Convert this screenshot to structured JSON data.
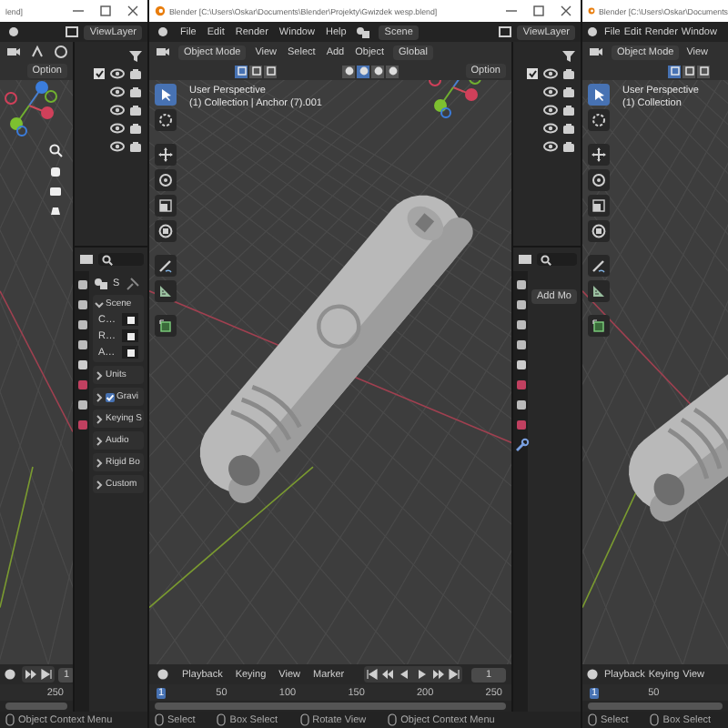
{
  "windows": [
    {
      "title": "lend]",
      "controls": true,
      "view_layer": "ViewLayer",
      "options": "Option",
      "gizmo": true,
      "nav_buttons": true,
      "outliner": true,
      "properties": {
        "breadcrumb": "S",
        "panels": [
          {
            "kind": "plain",
            "label": "Scene",
            "expanded": true,
            "rows": [
              "C…",
              "R…",
              "A…"
            ]
          },
          {
            "kind": "plain",
            "label": "Units",
            "expanded": false
          },
          {
            "kind": "checkbox",
            "label": "Gravi",
            "expanded": false,
            "checked": true
          },
          {
            "kind": "plain",
            "label": "Keying S",
            "expanded": false
          },
          {
            "kind": "plain",
            "label": "Audio",
            "expanded": false
          },
          {
            "kind": "plain",
            "label": "Rigid Bo",
            "expanded": false
          },
          {
            "kind": "plain",
            "label": "Custom",
            "expanded": false
          }
        ]
      },
      "timeline": {
        "frame": "1",
        "ruler": [
          {
            "label": "250",
            "selected": false
          }
        ]
      },
      "status": [
        "Object Context Menu"
      ]
    },
    {
      "title": "Blender [C:\\Users\\Oskar\\Documents\\Blender\\Projekty\\Gwizdek wesp.blend]",
      "app_icon": true,
      "controls": true,
      "menus": [
        "File",
        "Edit",
        "Render",
        "Window",
        "Help"
      ],
      "scene": "Scene",
      "view_layer": "ViewLayer",
      "mode": "Object Mode",
      "header_menus": [
        "View",
        "Select",
        "Add",
        "Object"
      ],
      "orientation": "Global",
      "options": "Option",
      "select_modes": [
        {
          "selected": true
        },
        {
          "selected": false
        },
        {
          "selected": false
        }
      ],
      "shading": [
        {
          "selected": false
        },
        {
          "selected": true
        },
        {
          "selected": false
        },
        {
          "selected": false
        }
      ],
      "info": [
        "User Perspective",
        "(1) Collection | Anchor (7).001"
      ],
      "tools": [
        {
          "kind": "select",
          "selected": true
        },
        {
          "kind": "cursor",
          "selected": false
        },
        {
          "kind": "move",
          "selected": false
        },
        {
          "kind": "rotate",
          "selected": false
        },
        {
          "kind": "scale",
          "selected": false
        },
        {
          "kind": "transform",
          "selected": false
        },
        {
          "kind": "annotate",
          "selected": false
        },
        {
          "kind": "measure",
          "selected": false
        },
        {
          "kind": "add",
          "selected": false
        }
      ],
      "gizmo": true,
      "model": true,
      "outliner": true,
      "properties": {
        "button": "Add Mo"
      },
      "timeline": {
        "menus": [
          "Playback",
          "Keying",
          "View",
          "Marker"
        ],
        "frame": "1",
        "ruler": [
          {
            "label": "1",
            "selected": true
          },
          {
            "label": "50",
            "selected": false
          },
          {
            "label": "100",
            "selected": false
          },
          {
            "label": "150",
            "selected": false
          },
          {
            "label": "200",
            "selected": false
          },
          {
            "label": "250",
            "selected": false
          }
        ]
      },
      "status": [
        "Select",
        "Box Select",
        "Rotate View",
        "Object Context Menu"
      ]
    },
    {
      "title": "Blender [C:\\Users\\Oskar\\Documents",
      "app_icon": true,
      "menus": [
        "File",
        "Edit",
        "Render",
        "Window"
      ],
      "mode": "Object Mode",
      "header_menus": [
        "View"
      ],
      "select_modes": [
        {
          "selected": true
        },
        {
          "selected": false
        },
        {
          "selected": false
        }
      ],
      "info": [
        "User Perspective",
        "(1) Collection"
      ],
      "tools": [
        {
          "kind": "select",
          "selected": true
        },
        {
          "kind": "cursor",
          "selected": false
        },
        {
          "kind": "move",
          "selected": false
        },
        {
          "kind": "rotate",
          "selected": false
        },
        {
          "kind": "scale",
          "selected": false
        },
        {
          "kind": "transform",
          "selected": false
        },
        {
          "kind": "annotate",
          "selected": false
        },
        {
          "kind": "measure",
          "selected": false
        },
        {
          "kind": "add",
          "selected": false
        }
      ],
      "model": true,
      "timeline": {
        "menus": [
          "Playback",
          "Keying",
          "View"
        ],
        "ruler": [
          {
            "label": "1",
            "selected": true
          },
          {
            "label": "50",
            "selected": false
          }
        ]
      },
      "status": [
        "Select",
        "Box Select"
      ]
    }
  ]
}
